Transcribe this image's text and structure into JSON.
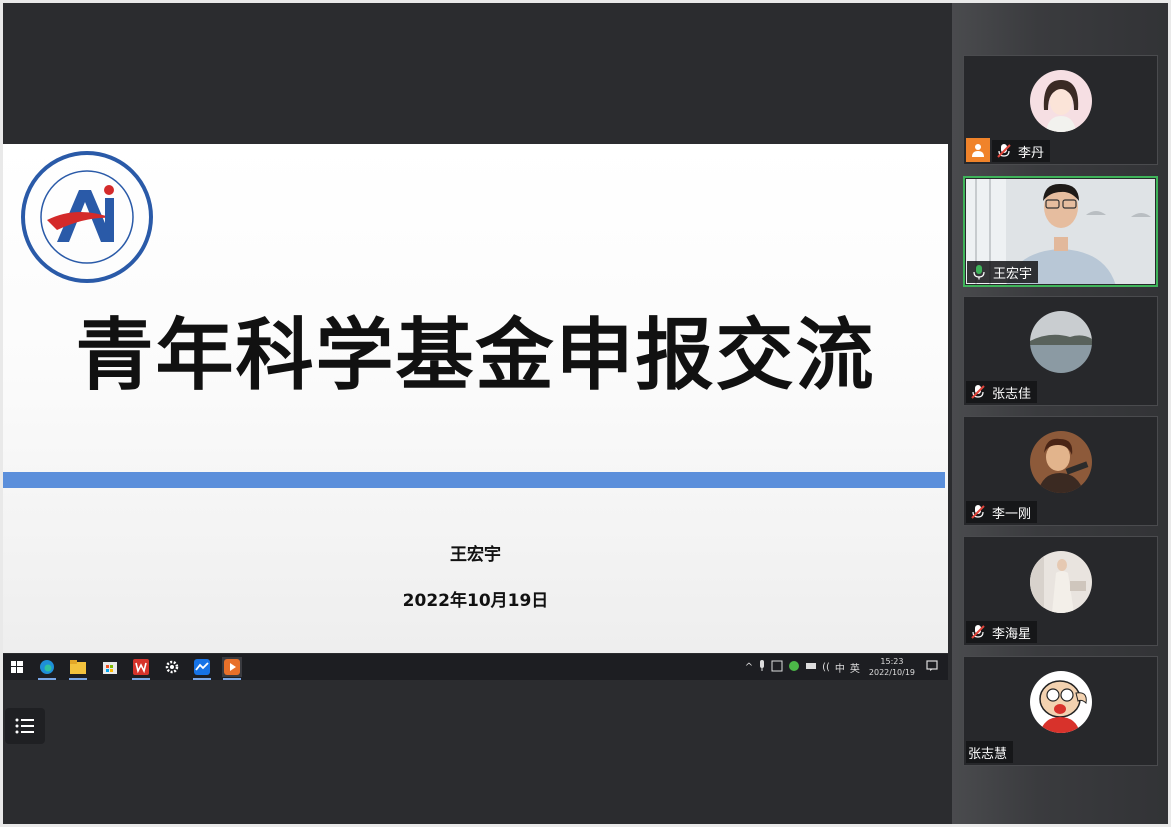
{
  "slide": {
    "title": "青年科学基金申报交流",
    "presenter": "王宏宇",
    "date": "2022年10月19日"
  },
  "taskbar": {
    "ime": "英",
    "volume": "中",
    "time": "15:23",
    "date": "2022/10/19"
  },
  "participants": [
    {
      "name": "李丹",
      "muted": true,
      "host": true
    },
    {
      "name": "王宏宇",
      "muted": false,
      "speaking": true
    },
    {
      "name": "张志佳",
      "muted": true
    },
    {
      "name": "李一刚",
      "muted": true
    },
    {
      "name": "李海星",
      "muted": true
    },
    {
      "name": "张志慧",
      "muted": true
    }
  ],
  "colors": {
    "accent_blue": "#5b8fdb",
    "active_border": "#3fb45a",
    "host_orange": "#f0832a",
    "muted_red": "#e0463c"
  }
}
